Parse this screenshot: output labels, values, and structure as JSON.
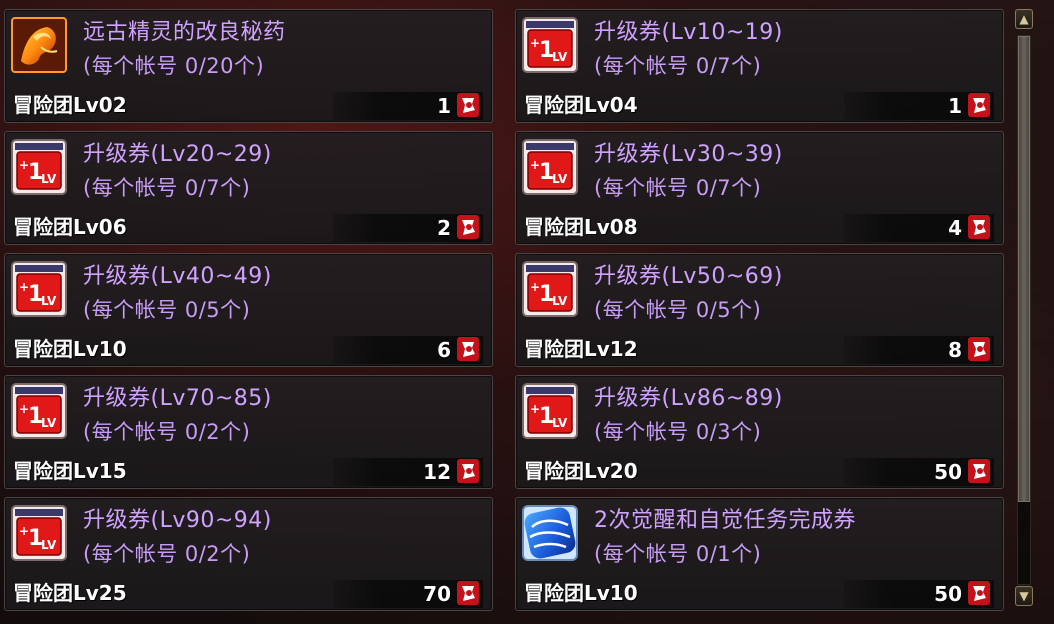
{
  "items": [
    {
      "name": "远古精灵的改良秘药",
      "limit": "(每个帐号 0/20个)",
      "level": "冒险团Lv02",
      "price": "1",
      "icon": "elixir-icon"
    },
    {
      "name": "升级券(Lv10~19)",
      "limit": "(每个帐号 0/7个)",
      "level": "冒险团Lv04",
      "price": "1",
      "icon": "level-up-ticket-icon"
    },
    {
      "name": "升级券(Lv20~29)",
      "limit": "(每个帐号 0/7个)",
      "level": "冒险团Lv06",
      "price": "2",
      "icon": "level-up-ticket-icon"
    },
    {
      "name": "升级券(Lv30~39)",
      "limit": "(每个帐号 0/7个)",
      "level": "冒险团Lv08",
      "price": "4",
      "icon": "level-up-ticket-icon"
    },
    {
      "name": "升级券(Lv40~49)",
      "limit": "(每个帐号 0/5个)",
      "level": "冒险团Lv10",
      "price": "6",
      "icon": "level-up-ticket-icon"
    },
    {
      "name": "升级券(Lv50~69)",
      "limit": "(每个帐号 0/5个)",
      "level": "冒险团Lv12",
      "price": "8",
      "icon": "level-up-ticket-icon"
    },
    {
      "name": "升级券(Lv70~85)",
      "limit": "(每个帐号 0/2个)",
      "level": "冒险团Lv15",
      "price": "12",
      "icon": "level-up-ticket-icon"
    },
    {
      "name": "升级券(Lv86~89)",
      "limit": "(每个帐号 0/3个)",
      "level": "冒险团Lv20",
      "price": "50",
      "icon": "level-up-ticket-icon"
    },
    {
      "name": "升级券(Lv90~94)",
      "limit": "(每个帐号 0/2个)",
      "level": "冒险团Lv25",
      "price": "70",
      "icon": "level-up-ticket-icon"
    },
    {
      "name": "2次觉醒和自觉任务完成券",
      "limit": "(每个帐号 0/1个)",
      "level": "冒险团Lv10",
      "price": "50",
      "icon": "awakening-quest-ticket-icon"
    }
  ],
  "currency_icon": "adventure-coin-icon",
  "scroll": {
    "up_icon": "scroll-up-icon",
    "down_icon": "scroll-down-icon"
  }
}
